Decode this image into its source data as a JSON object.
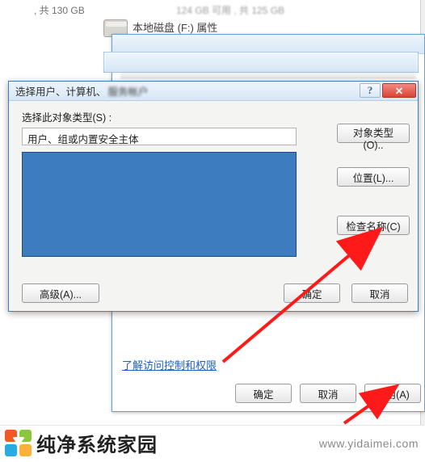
{
  "background": {
    "storage_summary": ", 共 130 GB",
    "other_drive_summary": "124 GB 可用 , 共 125 GB",
    "drive_label": "本地磁盘 (F:) 属性"
  },
  "select_dialog": {
    "title_prefix": "选择用户、计算机、",
    "title_blurred": "服务帐户",
    "object_type_label": "选择此对象类型(S) :",
    "object_type_value": "用户、组或内置安全主体",
    "object_types_button": "对象类型(O)..",
    "locations_button": "位置(L)...",
    "check_names_button": "检查名称(C)",
    "advanced_button": "高级(A)...",
    "ok_button": "确定",
    "cancel_button": "取消"
  },
  "properties_dialog": {
    "help_link": "了解访问控制和权限",
    "ok_button": "确定",
    "cancel_button": "取消",
    "apply_button": "应用(A)"
  },
  "footer": {
    "brand": "纯净系统家园",
    "url": "www.yidaimei.com"
  }
}
